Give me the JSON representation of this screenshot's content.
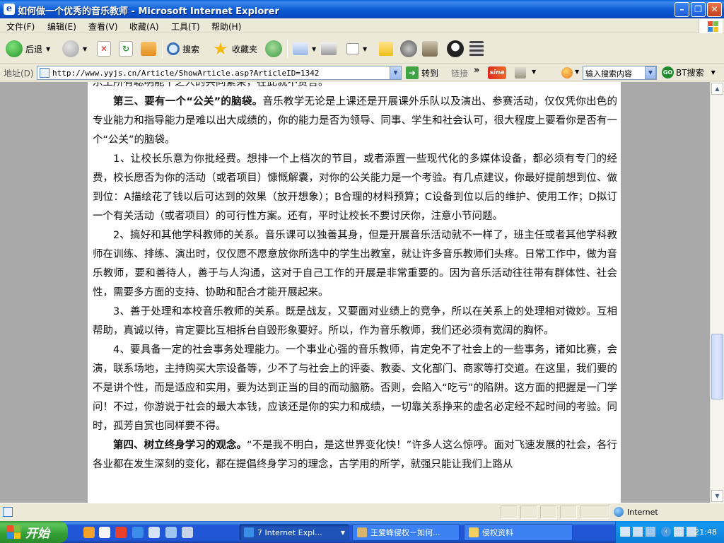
{
  "window": {
    "title": "如何做一个优秀的音乐教师 - Microsoft Internet Explorer",
    "app_icon": "ie-page-icon",
    "controls": [
      "minimize",
      "maximize",
      "close"
    ]
  },
  "menu": [
    "文件(F)",
    "编辑(E)",
    "查看(V)",
    "收藏(A)",
    "工具(T)",
    "帮助(H)"
  ],
  "toolbar": {
    "back_label": "后退",
    "search_label": "搜索",
    "favorites_label": "收藏夹"
  },
  "address": {
    "label": "地址(D)",
    "url": "http://www.yyjs.cn/Article/ShowArticle.asp?ArticleID=1342",
    "go_label": "转到",
    "links_label": "链接",
    "search_placeholder": "输入搜索内容",
    "bt_search_label": "BT搜索"
  },
  "article": {
    "top_fragment": "乐工所有聪明能干之人的共同繁荣，在此就不赘言。",
    "p1_heading": "第三、要有一个“公关”的脑袋。",
    "p1_text": "音乐教学无论是上课还是开展课外乐队以及演出、参赛活动，仅仅凭你出色的专业能力和指导能力是难以出大成绩的，你的能力是否为领导、同事、学生和社会认可，很大程度上要看你是否有一个“公关”的脑袋。",
    "p2_text": "1、让校长乐意为你批经费。想排一个上档次的节目，或者添置一些现代化的多媒体设备，都必须有专门的经费，校长愿否为你的活动（或者项目）慷慨解囊，对你的公关能力是一个考验。有几点建议，你最好提前想到位、做到位：A描绘花了钱以后可达到的效果（放开想象）；B合理的材料预算；C设备到位以后的维护、使用工作；D拟订一个有关活动（或者项目）的可行性方案。还有，平时让校长不要讨厌你，注意小节问题。",
    "p3_text": "2、搞好和其他学科教师的关系。音乐课可以独善其身，但是开展音乐活动就不一样了，班主任或者其他学科教师在训练、排练、演出时，仅仅愿不愿意放你所选中的学生出教室，就让许多音乐教师们头疼。日常工作中，做为音乐教师，要和善待人，善于与人沟通，这对于自己工作的开展是非常重要的。因为音乐活动往往带有群体性、社会性，需要多方面的支持、协助和配合才能开展起来。",
    "p4_text": "3、善于处理和本校音乐教师的关系。既是战友，又要面对业绩上的竞争，所以在关系上的处理相对微妙。互相帮助，真诚以待，肯定要比互相拆台自毁形象要好。所以，作为音乐教师，我们还必须有宽阔的胸怀。",
    "p5_text": "4、要具备一定的社会事务处理能力。一个事业心强的音乐教师，肯定免不了社会上的一些事务，诸如比赛，会演，联系场地，主持购买大宗设备等，少不了与社会上的评委、教委、文化部门、商家等打交道。在这里，我们要的不是讲个性，而是适应和实用，要为达到正当的目的而动脑筋。否则，会陷入“吃亏”的陷阱。这方面的把握是一门学问！不过，你游说于社会的最大本钱，应该还是你的实力和成绩，一切靠关系挣来的虚名必定经不起时间的考验。同时，孤芳自赏也同样要不得。",
    "p6_heading": "第四、树立终身学习的观念。",
    "p6_text": "“不是我不明白，是这世界变化快！”许多人这么惊呼。面对飞速发展的社会，各行各业都在发生深刻的变化，都在提倡终身学习的理念，古学用的所学，就强只能让我们上路从"
  },
  "status": {
    "zone_label": "Internet"
  },
  "taskbar": {
    "start_label": "开始",
    "tasks": [
      "7 Internet Expl...",
      "王爱峰侵权－如何...",
      "侵权资料"
    ],
    "clock": "21:48"
  },
  "colors": {
    "titlebar": "#0b58d2",
    "taskbar": "#2157d7",
    "start_button": "#339e34",
    "page_background": "#a9a9a9",
    "article_background": "#ffffff"
  }
}
